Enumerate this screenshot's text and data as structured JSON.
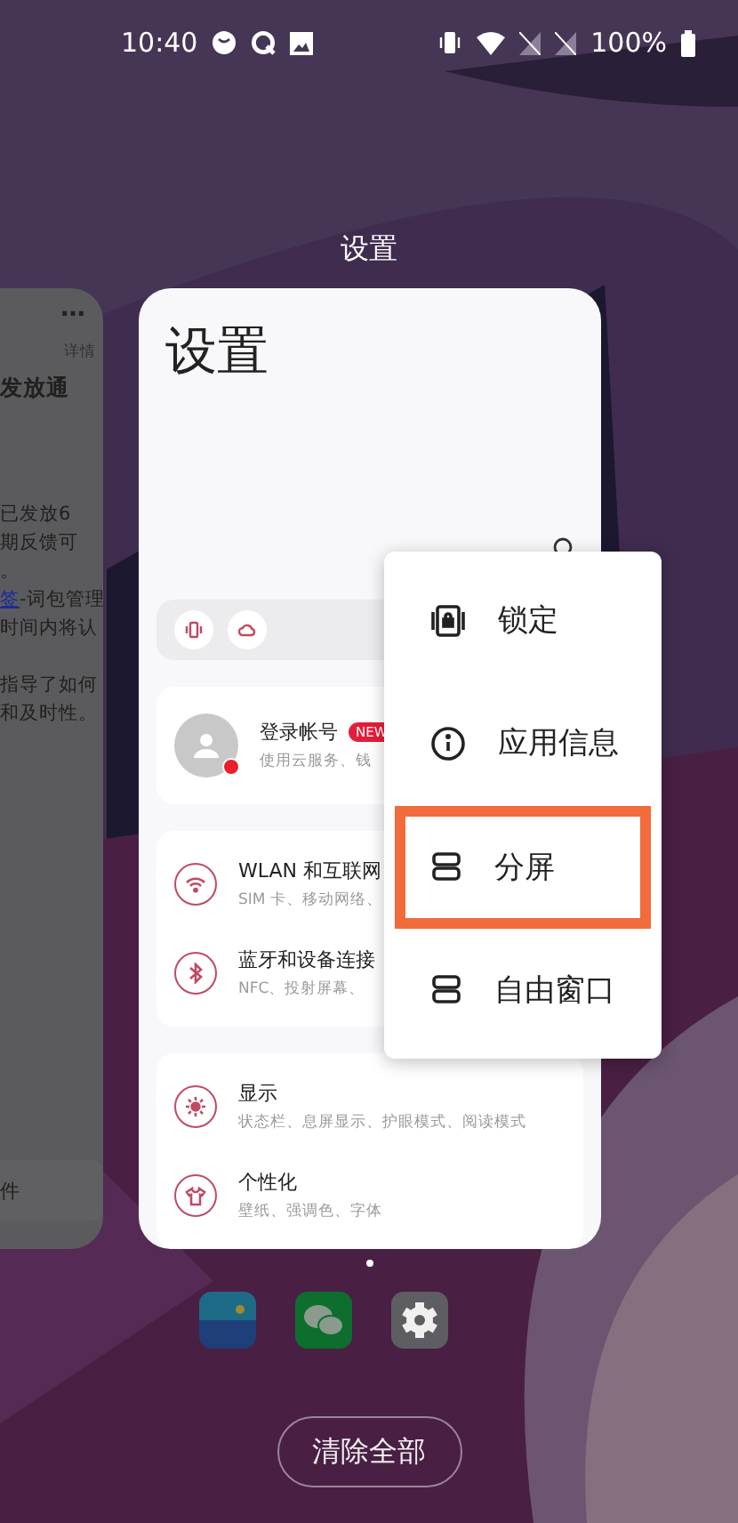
{
  "status_bar": {
    "time": "10:40",
    "battery": "100%"
  },
  "recents": {
    "title": "设置",
    "side_card": {
      "more": "⋯",
      "detail": "详情",
      "heading": "发放通",
      "lines": [
        {
          "text": "已发放6",
          "kind": "plain"
        },
        {
          "text": "期反馈可",
          "kind": "plain"
        },
        {
          "text": "。",
          "kind": "plain"
        },
        {
          "text": "签",
          "kind": "link",
          "rest": "-词包管理"
        },
        {
          "text": "时间内将认",
          "kind": "plain"
        },
        {
          "text": "指导了如何",
          "kind": "plain"
        },
        {
          "text": "和及时性。",
          "kind": "plain"
        }
      ],
      "footer": "件"
    },
    "main_card": {
      "title": "设置",
      "account": {
        "name": "登录帐号",
        "badge": "NEW",
        "subtitle": "使用云服务、钱",
        "notify": true
      },
      "groups": [
        [
          {
            "kind": "wifi",
            "title": "WLAN 和互联网",
            "subtitle": "SIM 卡、移动网络、"
          },
          {
            "kind": "bluetooth",
            "title": "蓝牙和设备连接",
            "subtitle": "NFC、投射屏幕、"
          }
        ],
        [
          {
            "kind": "display",
            "title": "显示",
            "subtitle": "状态栏、息屏显示、护眼模式、阅读模式"
          },
          {
            "kind": "personalize",
            "title": "个性化",
            "subtitle": "壁纸、强调色、字体"
          }
        ]
      ]
    },
    "menu": [
      {
        "kind": "lock",
        "label": "锁定",
        "highlighted": false
      },
      {
        "kind": "info",
        "label": "应用信息",
        "highlighted": false
      },
      {
        "kind": "split",
        "label": "分屏",
        "highlighted": true
      },
      {
        "kind": "window",
        "label": "自由窗口",
        "highlighted": false
      }
    ]
  },
  "dock": [
    {
      "kind": "wallet"
    },
    {
      "kind": "chat"
    },
    {
      "kind": "settings"
    }
  ],
  "clear_button": "清除全部"
}
